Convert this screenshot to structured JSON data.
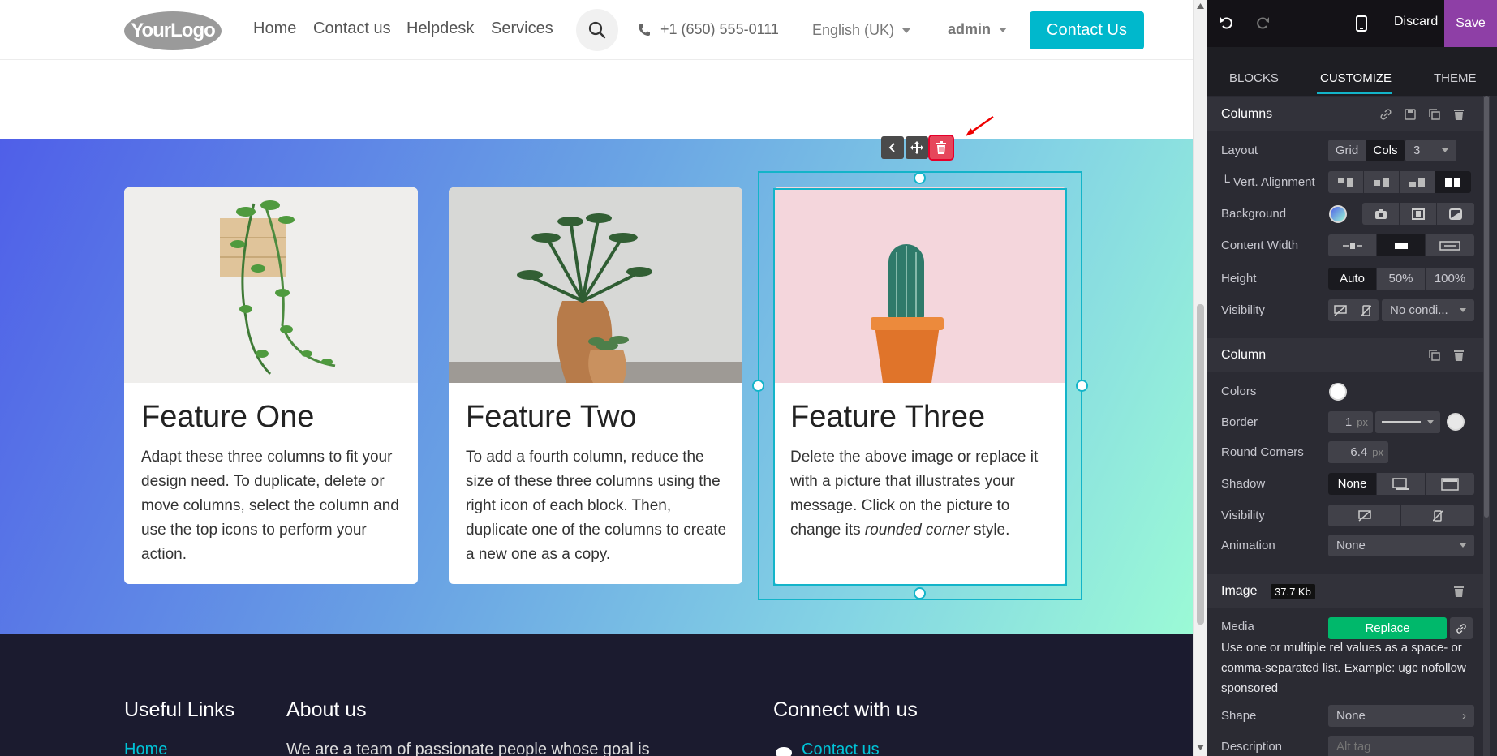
{
  "header": {
    "logo_text": "YourLogo",
    "nav": [
      "Home",
      "Contact us",
      "Helpdesk",
      "Services"
    ],
    "phone": "+1 (650) 555-0111",
    "language": "English (UK)",
    "user": "admin",
    "cta_label": "Contact Us"
  },
  "features": {
    "cards": [
      {
        "title": "Feature One",
        "text": "Adapt these three columns to fit your design need. To duplicate, delete or move columns, select the column and use the top icons to perform your action."
      },
      {
        "title": "Feature Two",
        "text": "To add a fourth column, reduce the size of these three columns using the right icon of each block. Then, duplicate one of the columns to create a new one as a copy."
      },
      {
        "title": "Feature Three",
        "text_before": "Delete the above image or replace it with a picture that illustrates your message. Click on the picture to change its ",
        "text_em": "rounded corner",
        "text_after": " style."
      }
    ]
  },
  "footer": {
    "col1_title": "Useful Links",
    "col1_link": "Home",
    "col2_title": "About us",
    "col2_text": "We are a team of passionate people whose goal is",
    "col3_title": "Connect with us",
    "col3_link": "Contact us"
  },
  "panel": {
    "discard_label": "Discard",
    "save_label": "Save",
    "tabs": [
      "BLOCKS",
      "CUSTOMIZE",
      "THEME"
    ],
    "active_tab": "CUSTOMIZE",
    "columns_section": {
      "title": "Columns",
      "layout_label": "Layout",
      "layout_options": [
        "Grid",
        "Cols"
      ],
      "layout_selected": "Cols",
      "cols_value": "3",
      "vert_align_label": "└ Vert. Alignment",
      "background_label": "Background",
      "content_width_label": "Content Width",
      "height_label": "Height",
      "height_options": [
        "Auto",
        "50%",
        "100%"
      ],
      "height_selected": "Auto",
      "visibility_label": "Visibility",
      "visibility_value": "No condi..."
    },
    "column_section": {
      "title": "Column",
      "colors_label": "Colors",
      "border_label": "Border",
      "border_width": "1",
      "border_unit": "px",
      "round_corners_label": "Round Corners",
      "round_corners_value": "6.4",
      "round_corners_unit": "px",
      "shadow_label": "Shadow",
      "shadow_selected": "None",
      "visibility_label": "Visibility",
      "animation_label": "Animation",
      "animation_value": "None"
    },
    "image_section": {
      "title": "Image",
      "size_badge": "37.7 Kb",
      "media_label": "Media",
      "replace_label": "Replace",
      "help_text": "Use one or multiple rel values as a space- or comma-separated list. Example: ugc nofollow sponsored",
      "shape_label": "Shape",
      "shape_value": "None",
      "description_label": "Description",
      "description_placeholder": "Alt tag"
    }
  },
  "colors": {
    "accent": "#13b4c9",
    "cta": "#00b8cc",
    "save": "#8e3fa6",
    "replace": "#00b86b",
    "delete": "#e6465b",
    "footer_bg": "#1b1b2f",
    "panel_bg": "#2b2b33"
  },
  "icons": {
    "undo": "undo-icon",
    "redo": "redo-icon",
    "mobile": "mobile-preview-icon",
    "search": "search-icon",
    "phone": "phone-icon",
    "trash": "trash-icon",
    "move": "move-icon",
    "chevron": "chevron-left-icon"
  }
}
